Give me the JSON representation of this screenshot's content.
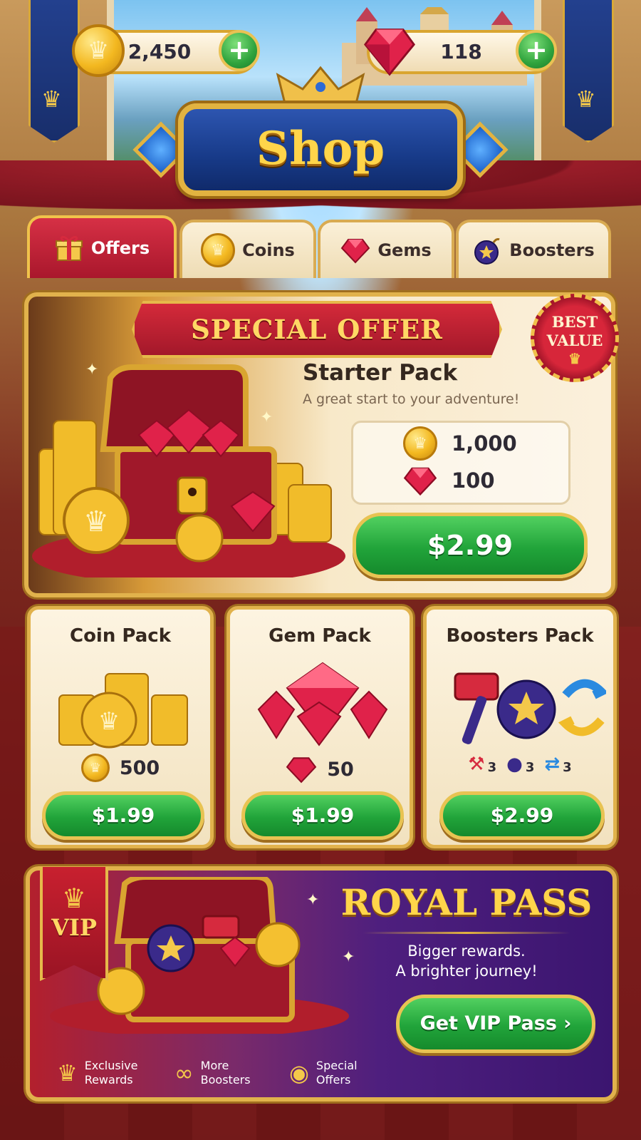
{
  "currency": {
    "coins": "2,450",
    "gems": "118",
    "add_label": "+"
  },
  "title": "Shop",
  "tabs": [
    {
      "label": "Offers",
      "icon": "gift-icon",
      "active": true
    },
    {
      "label": "Coins",
      "icon": "coin-icon",
      "active": false
    },
    {
      "label": "Gems",
      "icon": "gem-icon",
      "active": false
    },
    {
      "label": "Boosters",
      "icon": "bomb-icon",
      "active": false
    }
  ],
  "special_offer": {
    "ribbon": "SPECIAL OFFER",
    "badge_line1": "BEST",
    "badge_line2": "VALUE",
    "name": "Starter Pack",
    "description": "A great start to your adventure!",
    "coins": "1,000",
    "gems": "100",
    "price": "$2.99"
  },
  "packs": [
    {
      "title": "Coin Pack",
      "amount": "500",
      "price": "$1.99"
    },
    {
      "title": "Gem Pack",
      "amount": "50",
      "price": "$1.99"
    },
    {
      "title": "Boosters Pack",
      "hammer": "3",
      "bomb": "3",
      "swap": "3",
      "price": "$2.99"
    }
  ],
  "royal_pass": {
    "vip": "VIP",
    "title": "ROYAL PASS",
    "subtitle_line1": "Bigger rewards.",
    "subtitle_line2": "A brighter journey!",
    "button": "Get VIP Pass  ›",
    "perks": [
      {
        "line1": "Exclusive",
        "line2": "Rewards",
        "icon": "crown-icon"
      },
      {
        "line1": "More",
        "line2": "Boosters",
        "icon": "infinity-icon"
      },
      {
        "line1": "Special",
        "line2": "Offers",
        "icon": "coin-stack-icon"
      }
    ]
  },
  "colors": {
    "gold": "#e1b24c",
    "red": "#c8202f",
    "green": "#21a43a",
    "navy": "#173a88",
    "purple": "#4e1f7e"
  }
}
